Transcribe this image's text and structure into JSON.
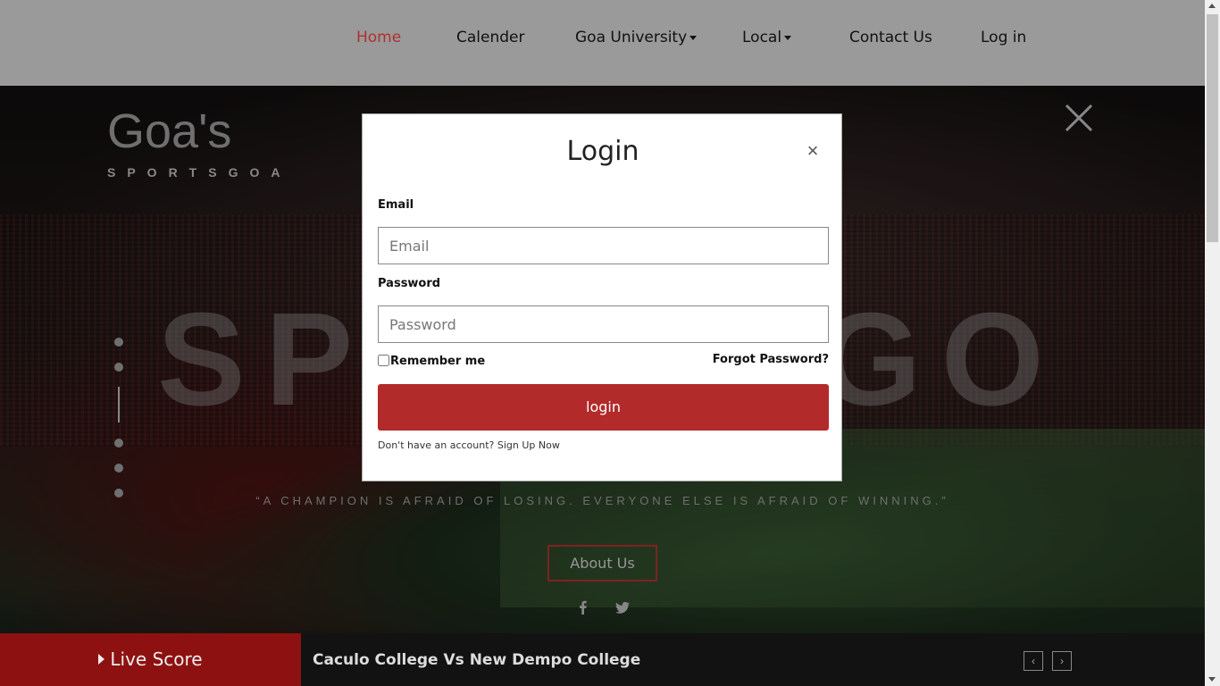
{
  "nav": {
    "items": [
      {
        "label": "Home",
        "active": true
      },
      {
        "label": "Calender"
      },
      {
        "label": "Goa University",
        "dropdown": true
      },
      {
        "label": "Local",
        "dropdown": true
      },
      {
        "label": "Contact Us"
      },
      {
        "label": "Log in"
      }
    ]
  },
  "brand": {
    "title": "Goa's",
    "subtitle": "SPORTSGOA"
  },
  "hero": {
    "watermark": "SPORTSGOA",
    "quote": "“A CHAMPION IS AFRAID OF LOSING. EVERYONE ELSE IS AFRAID OF WINNING.”",
    "about_label": "About Us"
  },
  "live": {
    "label": "Live Score",
    "match": "Caculo College Vs New Dempo College",
    "prev": "‹",
    "next": "›"
  },
  "modal": {
    "title": "Login",
    "close": "×",
    "email_label": "Email",
    "email_placeholder": "Email",
    "email_value": "",
    "password_label": "Password",
    "password_placeholder": "Password",
    "password_value": "",
    "remember_label": "Remember me",
    "remember_checked": false,
    "forgot_label": "Forgot Password?",
    "login_label": "login",
    "signup_prefix": "Don't have an account?",
    "signup_link": "Sign Up Now"
  },
  "colors": {
    "accent": "#b32a2a",
    "nav_bg": "#9a9a9a",
    "live_label_bg": "#8e1111",
    "active_nav": "#b03030"
  },
  "icons": [
    "close-icon",
    "facebook-icon",
    "twitter-icon",
    "caret-down-icon",
    "play-icon",
    "chevron-left-icon",
    "chevron-right-icon"
  ]
}
